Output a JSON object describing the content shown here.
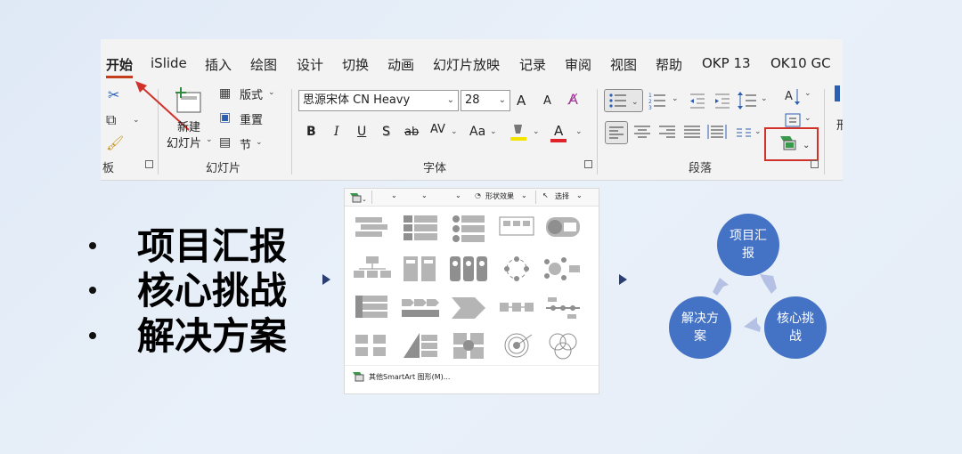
{
  "ribbon": {
    "tabs": [
      "开始",
      "iSlide",
      "插入",
      "绘图",
      "设计",
      "切换",
      "动画",
      "幻灯片放映",
      "记录",
      "审阅",
      "视图",
      "帮助",
      "OKP 13",
      "OK10 GC"
    ],
    "active_tab": "开始",
    "clipboard_group_label": "板",
    "slides_group": {
      "new_slide_line1": "新建",
      "new_slide_line2": "幻灯片",
      "layout": "版式",
      "reset": "重置",
      "section": "节",
      "label": "幻灯片"
    },
    "font_group": {
      "font_name": "思源宋体 CN Heavy",
      "font_size": "28",
      "grow": "A",
      "shrink": "A",
      "bold": "B",
      "italic": "I",
      "underline": "U",
      "shadow": "S",
      "strike": "ab",
      "spacing": "AV",
      "case": "Aa",
      "font_color": "A",
      "label": "字体"
    },
    "paragraph_group": {
      "label": "段落"
    },
    "highlight_color": "#d2312a"
  },
  "bullets": [
    "项目汇报",
    "核心挑战",
    "解决方案"
  ],
  "gallery": {
    "shape_effects": "形状效果",
    "select": "选择",
    "more_smartart": "其他SmartArt 图形(M)..."
  },
  "cycle": {
    "nodes": [
      "项目汇报",
      "核心挑战",
      "解决方案"
    ],
    "node_color": "#4472c4",
    "arrow_color": "#b4c1e4"
  }
}
